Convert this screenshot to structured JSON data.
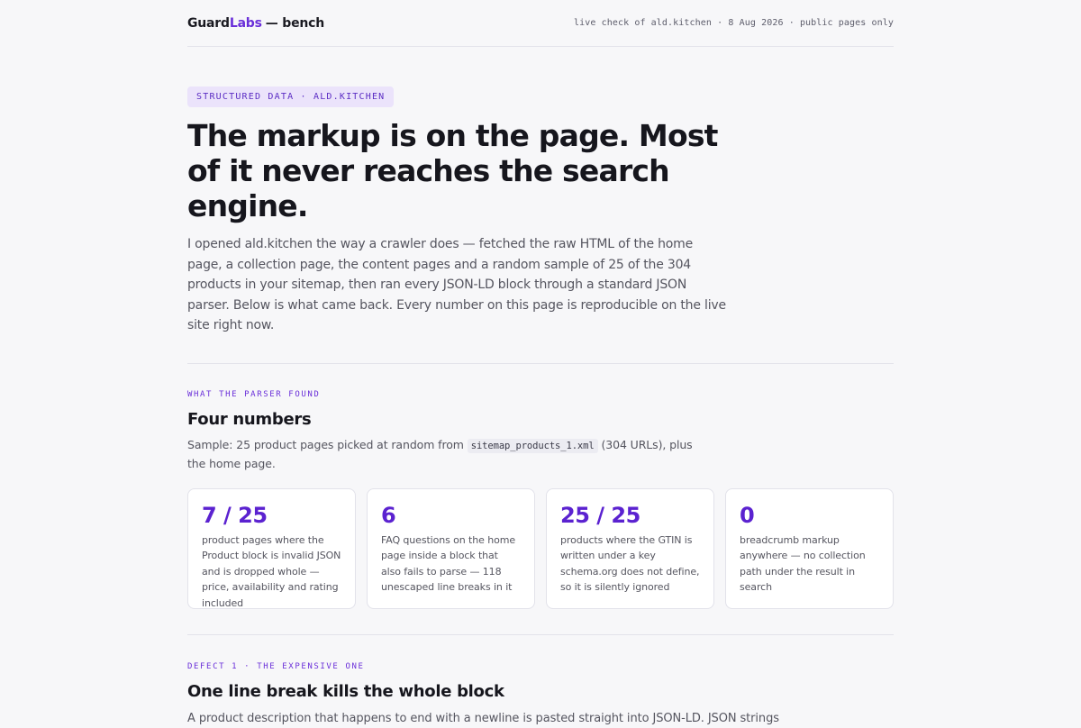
{
  "header": {
    "brand_guard": "Guard",
    "brand_labs": "Labs",
    "brand_rest": "— bench",
    "meta": "live check of ald.kitchen · 8 Aug 2026 · public pages only"
  },
  "hero": {
    "tag": "STRUCTURED DATA · ALD.KITCHEN",
    "title": "The markup is on the page. Most of it never reaches the search engine.",
    "lead": "I opened ald.kitchen the way a crawler does — fetched the raw HTML of the home page, a collection page, the content pages and a random sample of 25 of the 304 products in your sitemap, then ran every JSON-LD block through a standard JSON parser. Below is what came back. Every number on this page is reproducible on the live site right now."
  },
  "findings": {
    "kicker": "WHAT THE PARSER FOUND",
    "heading": "Four numbers",
    "sample_before": "Sample: 25 product pages picked at random from ",
    "sample_code": "sitemap_products_1.xml",
    "sample_after": " (304 URLs), plus the home page.",
    "cards": [
      {
        "value": "7 / 25",
        "text": "product pages where the Product block is invalid JSON and is dropped whole — price, availability and rating included"
      },
      {
        "value": "6",
        "text": "FAQ questions on the home page inside a block that also fails to parse — 118 unescaped line breaks in it"
      },
      {
        "value": "25 / 25",
        "text": "products where the GTIN is written under a key schema.org does not define, so it is silently ignored"
      },
      {
        "value": "0",
        "text": "breadcrumb markup anywhere — no collection path under the result in search"
      }
    ]
  },
  "defect1": {
    "kicker": "DEFECT 1 · THE EXPENSIVE ONE",
    "heading": "One line break kills the whole block",
    "text": "A product description that happens to end with a newline is pasted straight into JSON-LD. JSON strings"
  },
  "colors": {
    "accent": "#6a2fd9",
    "tag_bg": "#ebe3fb",
    "page_bg": "#f7f7f9"
  }
}
